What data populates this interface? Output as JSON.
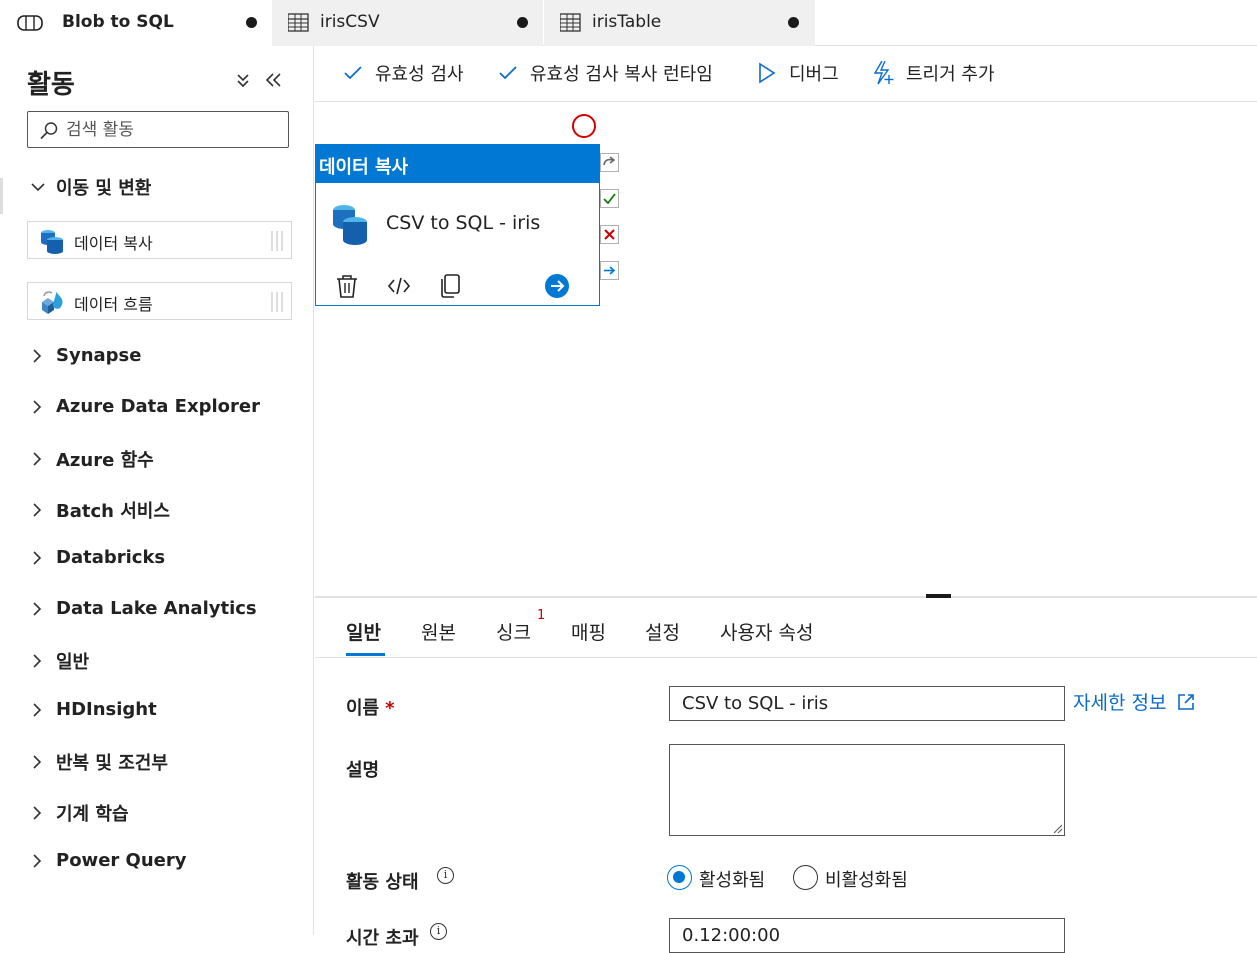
{
  "tabs": [
    {
      "label": "Blob to SQL",
      "unsaved": true,
      "active": true,
      "icon": "pipeline-icon"
    },
    {
      "label": "irisCSV",
      "unsaved": true,
      "active": false,
      "icon": "table-icon"
    },
    {
      "label": "irisTable",
      "unsaved": true,
      "active": false,
      "icon": "table-icon"
    }
  ],
  "sidebar": {
    "title": "활동",
    "search_placeholder": "검색 활동",
    "open_category": "이동 및 변환",
    "activities": [
      {
        "label": "데이터 복사",
        "icon": "copy-data-icon"
      },
      {
        "label": "데이터 흐름",
        "icon": "data-flow-icon"
      }
    ],
    "categories": [
      "Synapse",
      "Azure Data Explorer",
      "Azure 함수",
      "Batch 서비스",
      "Databricks",
      "Data Lake Analytics",
      "일반",
      "HDInsight",
      "반복 및 조건부",
      "기계 학습",
      "Power Query"
    ]
  },
  "toolbar": {
    "validate": "유효성 검사",
    "validate_runtime": "유효성 검사 복사 런타임",
    "debug": "디버그",
    "add_trigger": "트리거 추가"
  },
  "canvas": {
    "node": {
      "type_label": "데이터 복사",
      "name": "CSV to SQL - iris"
    }
  },
  "properties": {
    "tabs": [
      "일반",
      "원본",
      "싱크",
      "매핑",
      "설정",
      "사용자 속성"
    ],
    "active_tab": "일반",
    "sink_badge": "1",
    "name_label": "이름",
    "required_mark": "*",
    "name_value": "CSV to SQL - iris",
    "more_info": "자세한 정보",
    "description_label": "설명",
    "description_value": "",
    "state_label": "활동 상태",
    "state_options": [
      "활성화됨",
      "비활성화됨"
    ],
    "state_selected": "활성화됨",
    "timeout_label": "시간 초과",
    "timeout_value": "0.12:00:00"
  },
  "colors": {
    "accent": "#0078d4",
    "error": "#d80000",
    "success": "#107c10",
    "link": "#0b6bc7"
  }
}
